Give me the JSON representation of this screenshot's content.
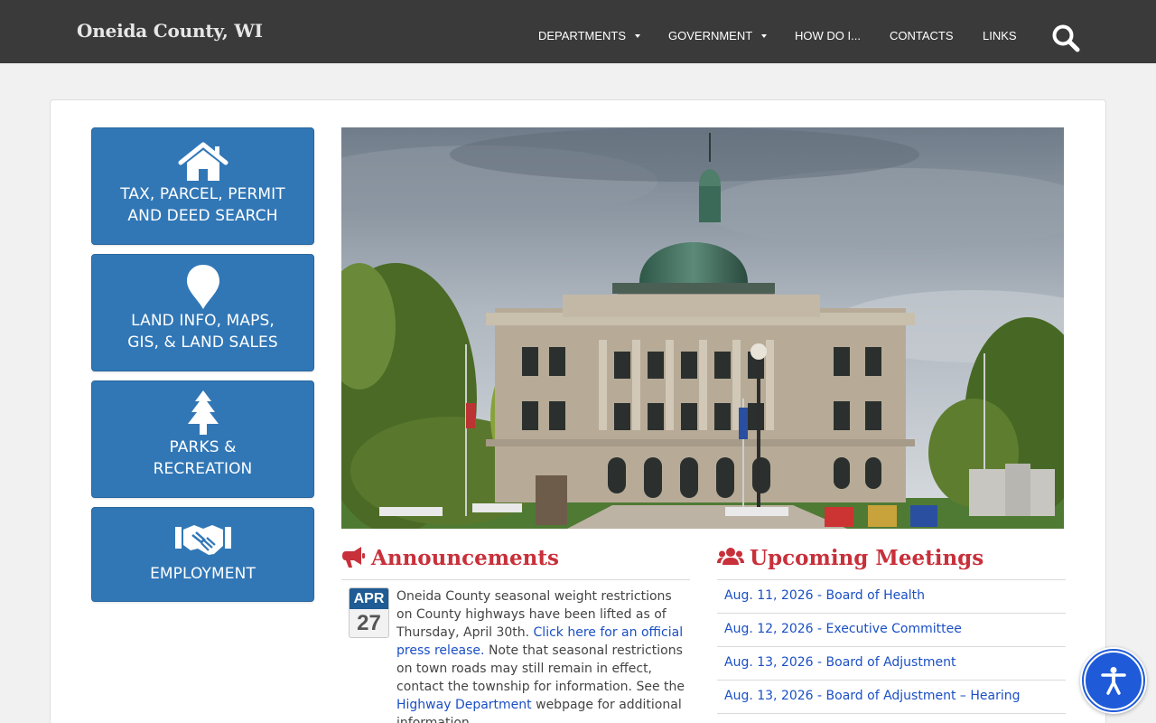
{
  "header": {
    "site_title": "Oneida County, WI",
    "nav": [
      {
        "label": "DEPARTMENTS",
        "has_dropdown": true
      },
      {
        "label": "GOVERNMENT",
        "has_dropdown": true
      },
      {
        "label": "HOW DO I...",
        "has_dropdown": false
      },
      {
        "label": "CONTACTS",
        "has_dropdown": false
      },
      {
        "label": "LINKS",
        "has_dropdown": false
      }
    ],
    "search_icon": "search-icon"
  },
  "quick_links": [
    {
      "line1": "TAX, PARCEL, PERMIT",
      "line2": "AND DEED SEARCH",
      "icon": "house-icon"
    },
    {
      "line1": "LAND INFO, MAPS,",
      "line2": "GIS, & LAND SALES",
      "icon": "map-pin-icon"
    },
    {
      "line1": "PARKS &",
      "line2": "RECREATION",
      "icon": "pine-tree-icon"
    },
    {
      "line1": "EMPLOYMENT",
      "line2": "",
      "icon": "handshake-icon"
    }
  ],
  "hero": {
    "image": "county-courthouse-photo"
  },
  "announcements": {
    "title": "Announcements",
    "icon": "megaphone-icon",
    "items": [
      {
        "month": "APR",
        "day": "27",
        "text_before": "Oneida County seasonal weight restrictions on County highways have been lifted as of Thursday, April 30th. ",
        "link1": "Click here for an official press release.",
        "text_middle": " Note that seasonal restrictions on town roads may still remain in effect, contact the township for information.  See the ",
        "link2": "Highway Department",
        "text_after": " webpage for additional information."
      }
    ]
  },
  "meetings": {
    "title": "Upcoming Meetings",
    "icon": "users-icon",
    "items": [
      {
        "label": "Aug. 11, 2026 - Board of Health"
      },
      {
        "label": "Aug. 12, 2026 - Executive Committee"
      },
      {
        "label": "Aug. 13, 2026 - Board of Adjustment"
      },
      {
        "label": "Aug. 13, 2026 - Board of Adjustment – Hearing"
      }
    ]
  },
  "accessibility": {
    "icon": "accessibility-icon"
  },
  "colors": {
    "header_bg": "#3a3a3a",
    "tile_blue": "#3177b6",
    "section_red": "#c8303a",
    "link_blue": "#1a4fc4",
    "date_blue": "#1f5b94"
  }
}
